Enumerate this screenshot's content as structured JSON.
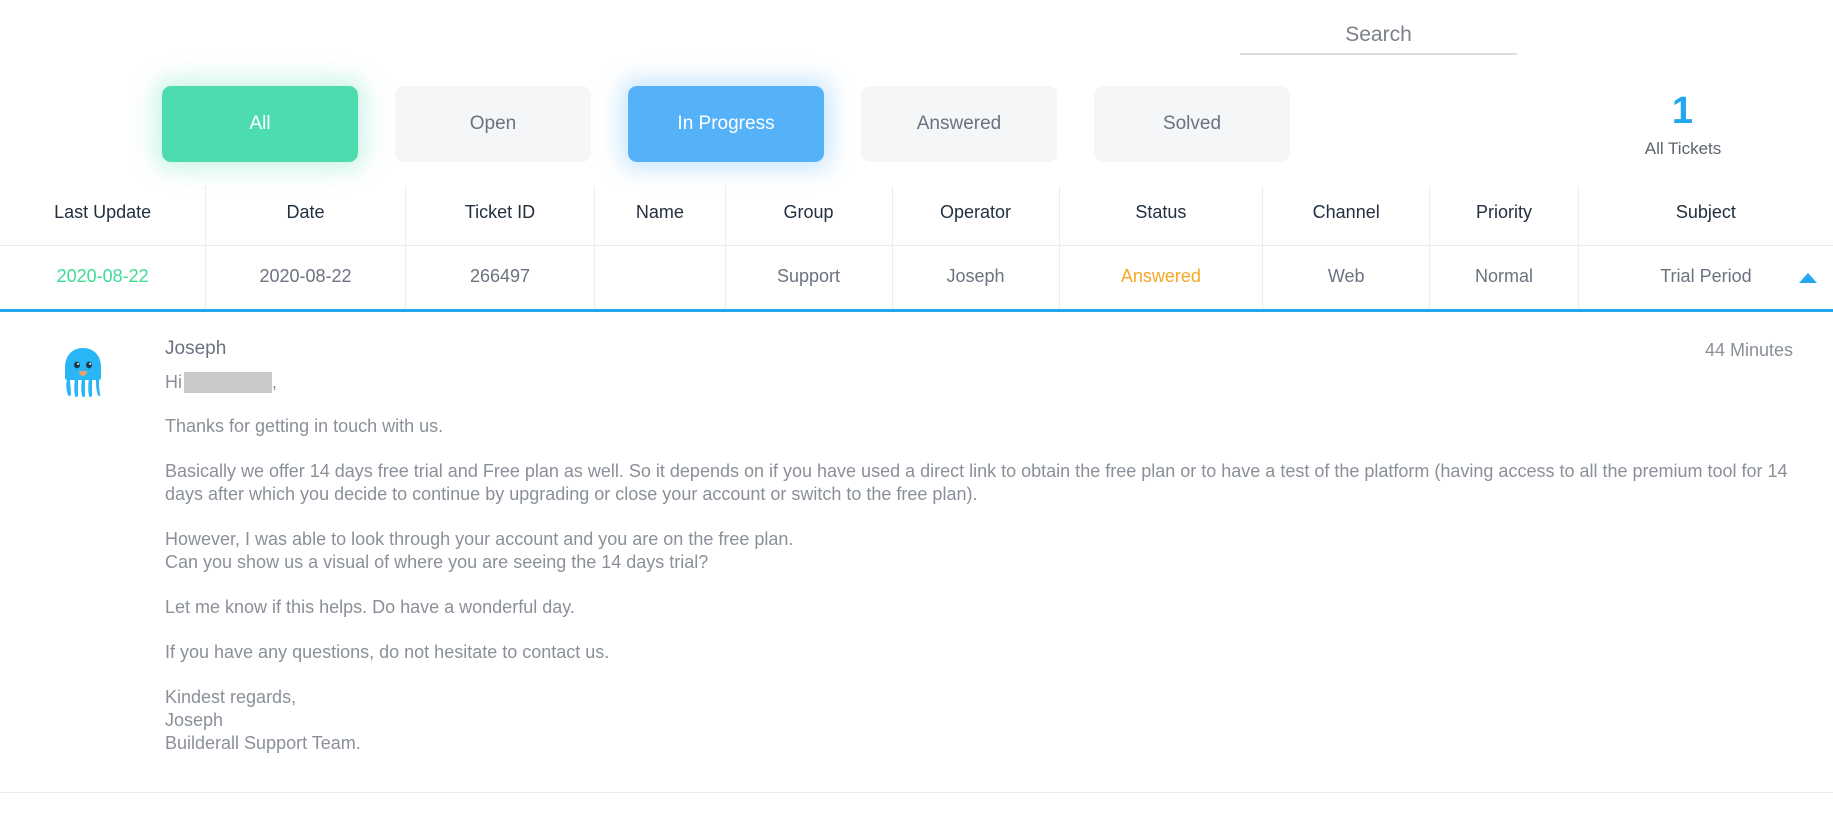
{
  "search": {
    "placeholder": "Search",
    "value": ""
  },
  "filters": {
    "buttons": [
      {
        "label": "All",
        "state": "active-green"
      },
      {
        "label": "Open",
        "state": "inactive"
      },
      {
        "label": "In Progress",
        "state": "active-blue"
      },
      {
        "label": "Answered",
        "state": "inactive"
      },
      {
        "label": "Solved",
        "state": "inactive"
      }
    ]
  },
  "counter": {
    "count": "1",
    "label": "All Tickets"
  },
  "table": {
    "columns": [
      "Last Update",
      "Date",
      "Ticket ID",
      "Name",
      "Group",
      "Operator",
      "Status",
      "Channel",
      "Priority",
      "Subject"
    ],
    "rows": [
      {
        "last_update": "2020-08-22",
        "date": "2020-08-22",
        "ticket_id": "266497",
        "name": "",
        "group": "Support",
        "operator": "Joseph",
        "status": "Answered",
        "channel": "Web",
        "priority": "Normal",
        "subject": "Trial Period"
      }
    ]
  },
  "message": {
    "author": "Joseph",
    "time": "44 Minutes",
    "greeting_prefix": "Hi",
    "greeting_suffix": ",",
    "paragraphs": [
      "Thanks for getting in touch with us.",
      "Basically we offer 14 days free trial and Free plan as well. So it depends on if you have used a direct link to obtain the free plan or to have a test of the platform (having access to all the premium tool for 14 days after which you decide to continue by upgrading or close your account or switch to the free plan).",
      "Let me know if this helps. Do have a wonderful day.",
      "If you have any questions, do not hesitate to contact us."
    ],
    "however_line_1": "However, I was able to look through your account and you are on the free plan.",
    "however_line_2": "Can you show us a visual of where you are seeing the 14 days trial?",
    "signature_line_1": "Kindest regards,",
    "signature_line_2": "Joseph",
    "signature_line_3": "Builderall Support Team."
  },
  "colors": {
    "green": "#4ddcb0",
    "blue": "#55b2f8",
    "accent_blue": "#22a7f0",
    "status_orange": "#f5a623",
    "last_update_green": "#3ddc97"
  }
}
